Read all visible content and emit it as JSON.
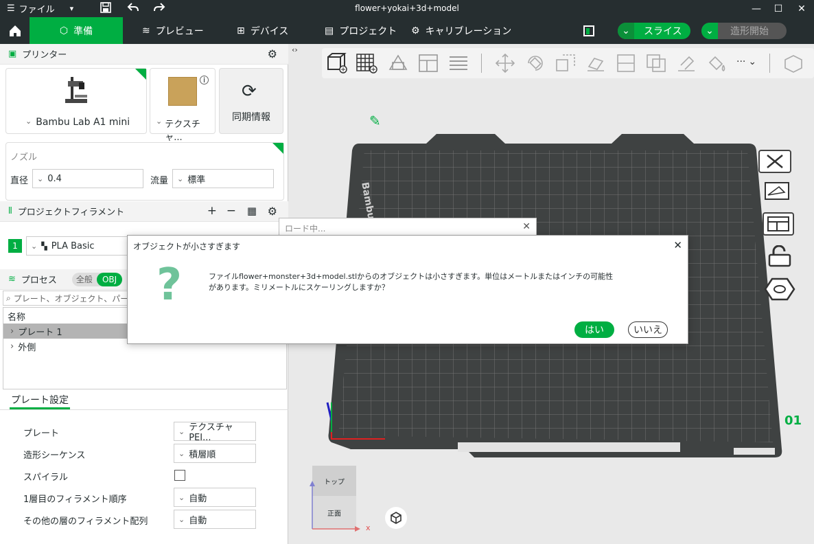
{
  "window": {
    "title": "flower+yokai+3d+model",
    "menu_label": "ファイル"
  },
  "nav": {
    "tabs": [
      "準備",
      "プレビュー",
      "デバイス",
      "プロジェクト",
      "キャリブレーション"
    ],
    "slice_label": "スライス",
    "print_label": "造形開始"
  },
  "printer": {
    "header": "プリンター",
    "printer_name": "Bambu Lab A1 mini",
    "plate_type": "テクスチャ...",
    "sync_label": "同期情報",
    "nozzle_header": "ノズル",
    "diameter_label": "直径",
    "diameter_value": "0.4",
    "flow_label": "流量",
    "flow_value": "標準"
  },
  "filament": {
    "header": "プロジェクトフィラメント",
    "index": "1",
    "name": "PLA Basic"
  },
  "process": {
    "header": "プロセス",
    "toggle_global": "全般",
    "toggle_obj": "OBJ",
    "search_placeholder": "プレート、オブジェクト、パーツを検索",
    "column_name": "名称",
    "items": [
      "プレート 1",
      "外側"
    ]
  },
  "plate_settings": {
    "tab": "プレート設定",
    "rows": [
      {
        "label": "プレート",
        "value": "テクスチャ PEI..."
      },
      {
        "label": "造形シーケンス",
        "value": "積層順"
      },
      {
        "label": "スパイラル",
        "value": ""
      },
      {
        "label": "1層目のフィラメント順序",
        "value": "自動"
      },
      {
        "label": "その他の層のフィラメント配列",
        "value": "自動"
      }
    ]
  },
  "viewport": {
    "bed_brand": "Bambu Textu",
    "plate_number": "01",
    "view_top": "トップ",
    "view_front": "正面",
    "axis_x": "x",
    "more_label": "···"
  },
  "loading": {
    "title": "ロード中..."
  },
  "dialog": {
    "title": "オブジェクトが小さすぎます",
    "message_line1": "ファイルflower+monster+3d+model.stlからのオブジェクトは小さすぎます。単位はメートルまたはインチの可能性",
    "message_line2": "があります。ミリメートルにスケーリングしますか？",
    "yes_label": "はい",
    "no_label": "いいえ"
  },
  "colors": {
    "accent": "#00ae42",
    "dark": "#262e30"
  }
}
